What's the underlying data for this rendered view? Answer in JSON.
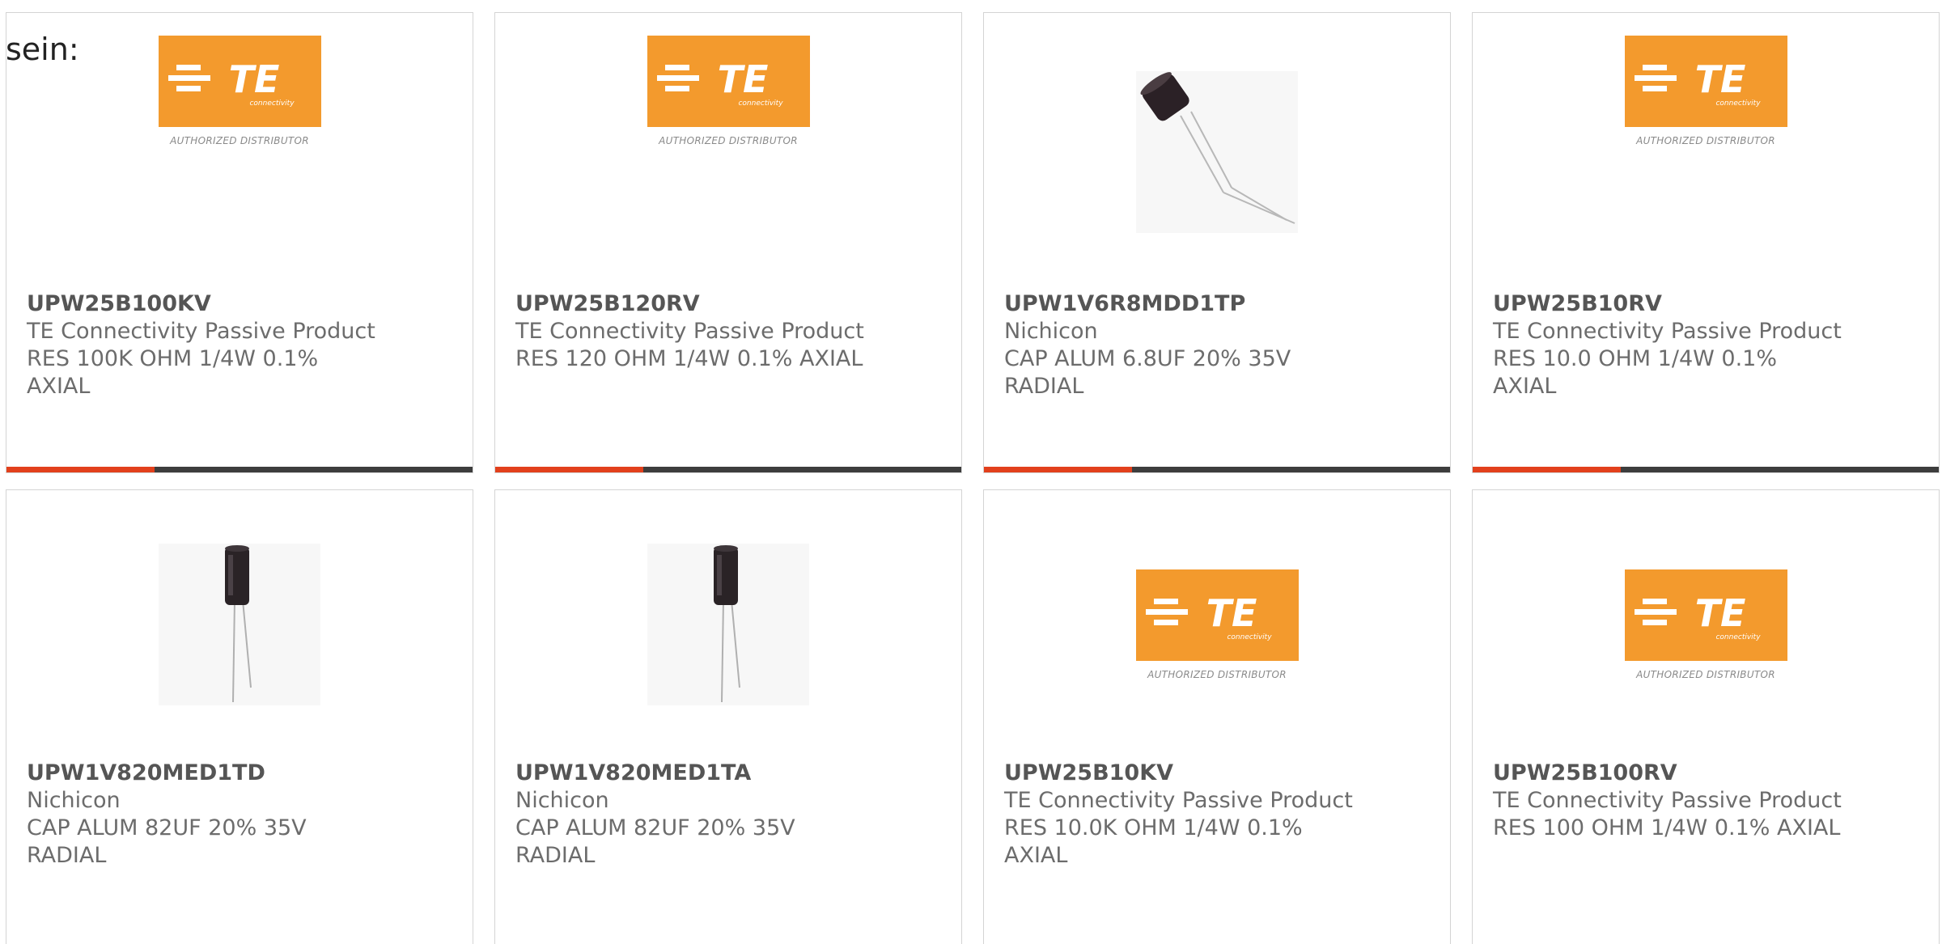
{
  "intro_text": "sein:",
  "colors": {
    "accent_bar": "#e2401c",
    "bar": "#3d3d3d",
    "te_orange": "#f39a2d"
  },
  "logo": {
    "brand": "TE",
    "sub": "connectivity",
    "caption": "AUTHORIZED DISTRIBUTOR"
  },
  "products": [
    {
      "part": "UPW25B100KV",
      "manufacturer": "TE Connectivity Passive Product",
      "description": "RES 100K OHM 1/4W 0.1% AXIAL",
      "image": "te-logo"
    },
    {
      "part": "UPW25B120RV",
      "manufacturer": "TE Connectivity Passive Product",
      "description": "RES 120 OHM 1/4W 0.1% AXIAL",
      "image": "te-logo"
    },
    {
      "part": "UPW1V6R8MDD1TP",
      "manufacturer": "Nichicon",
      "description": "CAP ALUM 6.8UF 20% 35V RADIAL",
      "image": "capacitor-bent"
    },
    {
      "part": "UPW25B10RV",
      "manufacturer": "TE Connectivity Passive Product",
      "description": "RES 10.0 OHM 1/4W 0.1% AXIAL",
      "image": "te-logo"
    },
    {
      "part": "UPW1V820MED1TD",
      "manufacturer": "Nichicon",
      "description": "CAP ALUM 82UF 20% 35V RADIAL",
      "image": "capacitor"
    },
    {
      "part": "UPW1V820MED1TA",
      "manufacturer": "Nichicon",
      "description": "CAP ALUM 82UF 20% 35V RADIAL",
      "image": "capacitor"
    },
    {
      "part": "UPW25B10KV",
      "manufacturer": "TE Connectivity Passive Product",
      "description": "RES 10.0K OHM 1/4W 0.1% AXIAL",
      "image": "te-logo"
    },
    {
      "part": "UPW25B100RV",
      "manufacturer": "TE Connectivity Passive Product",
      "description": "RES 100 OHM 1/4W 0.1% AXIAL",
      "image": "te-logo"
    }
  ]
}
